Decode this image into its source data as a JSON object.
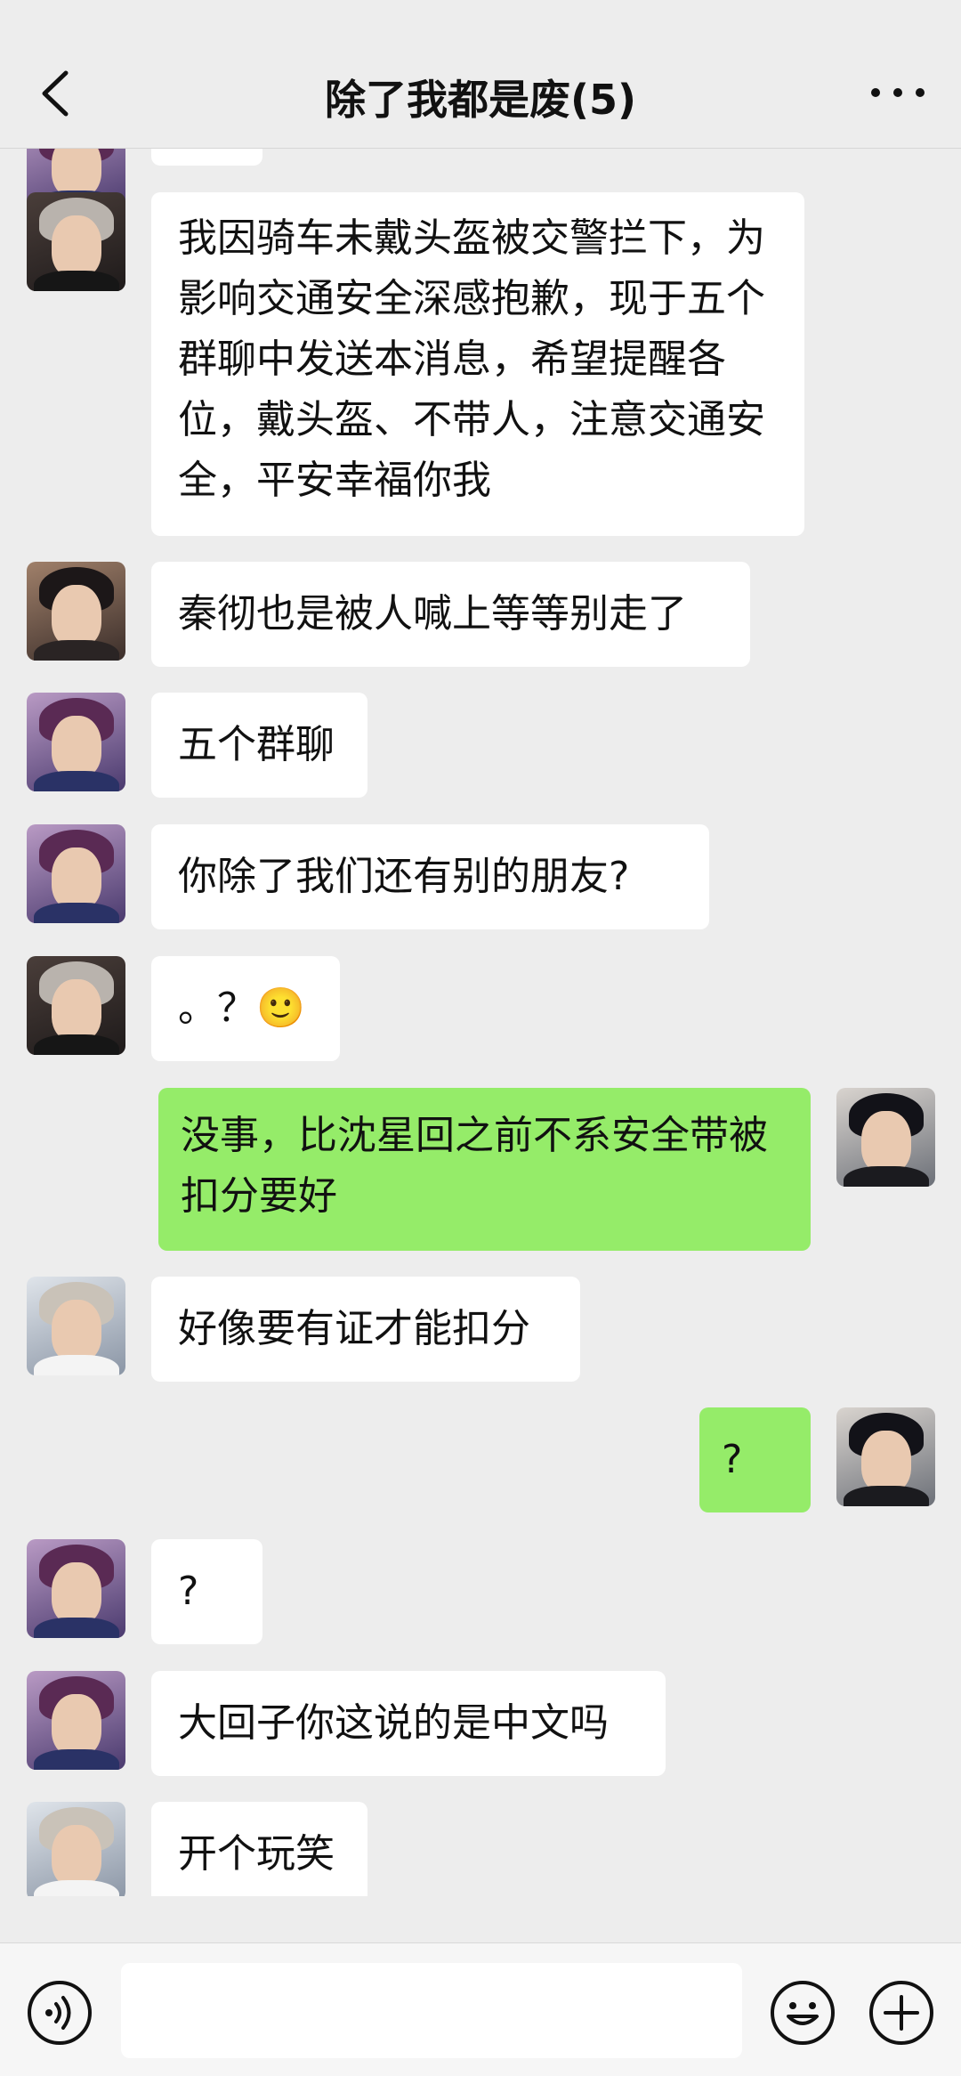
{
  "header": {
    "title": "除了我都是废(5)"
  },
  "messages": [
    {
      "sender": "grey-hair",
      "side": "left",
      "text": "我因骑车未戴头盔被交警拦下，为影响交通安全深感抱歉，现于五个群聊中发送本消息，希望提醒各位，戴头盔、不带人，注意交通安全，平安幸福你我"
    },
    {
      "sender": "black-hair",
      "side": "left",
      "text": "秦彻也是被人喊上等等别走了"
    },
    {
      "sender": "purple-hair",
      "side": "left",
      "text": "五个群聊"
    },
    {
      "sender": "purple-hair",
      "side": "left",
      "text": "你除了我们还有别的朋友?"
    },
    {
      "sender": "grey-hair",
      "side": "left",
      "text": "。？🙂"
    },
    {
      "sender": "self",
      "side": "right",
      "text": "没事，比沈星回之前不系安全带被扣分要好"
    },
    {
      "sender": "white-hair",
      "side": "left",
      "text": "好像要有证才能扣分"
    },
    {
      "sender": "self",
      "side": "right",
      "text": "?"
    },
    {
      "sender": "purple-hair",
      "side": "left",
      "text": "?"
    },
    {
      "sender": "purple-hair",
      "side": "left",
      "text": "大回子你这说的是中文吗"
    },
    {
      "sender": "white-hair",
      "side": "left",
      "text": "开个玩笑"
    }
  ],
  "input": {
    "placeholder": ""
  },
  "icons": {
    "back": "chevron-left-icon",
    "more": "more-dots-icon",
    "voice": "voice-icon",
    "emoji": "emoji-icon",
    "plus": "plus-icon"
  },
  "colors": {
    "background": "#ededed",
    "my_bubble": "#95ec69",
    "their_bubble": "#ffffff"
  }
}
